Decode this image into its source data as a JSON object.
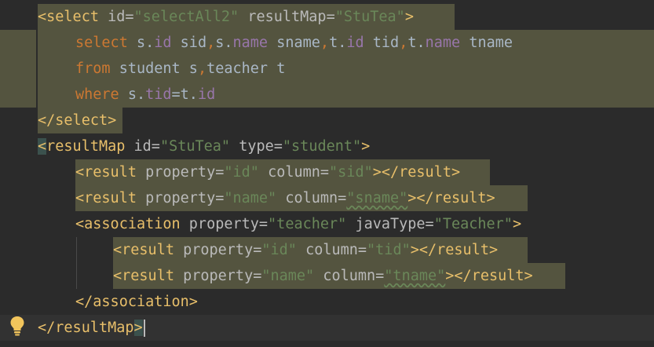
{
  "editor": {
    "lines": [
      {
        "id": "l1",
        "segments": [
          [
            "tag",
            "<select "
          ],
          [
            "attr",
            "id="
          ],
          [
            "str",
            "\"selectAll2\" "
          ],
          [
            "attr",
            "resultMap="
          ],
          [
            "str",
            "\"StuTea\""
          ],
          [
            "tag",
            ">"
          ]
        ]
      },
      {
        "id": "l2",
        "segments": [
          [
            "kw",
            "select "
          ],
          [
            "plain",
            "s."
          ],
          [
            "fld",
            "id "
          ],
          [
            "plain",
            "sid"
          ],
          [
            "kw",
            ","
          ],
          [
            "plain",
            "s."
          ],
          [
            "fld",
            "name "
          ],
          [
            "plain",
            "sname"
          ],
          [
            "kw",
            ","
          ],
          [
            "plain",
            "t."
          ],
          [
            "fld",
            "id "
          ],
          [
            "plain",
            "tid"
          ],
          [
            "kw",
            ","
          ],
          [
            "plain",
            "t."
          ],
          [
            "fld",
            "name "
          ],
          [
            "plain",
            "tname"
          ]
        ]
      },
      {
        "id": "l3",
        "segments": [
          [
            "kw",
            "from "
          ],
          [
            "plain",
            "student s"
          ],
          [
            "kw",
            ","
          ],
          [
            "plain",
            "teacher t"
          ]
        ]
      },
      {
        "id": "l4",
        "segments": [
          [
            "kw",
            "where "
          ],
          [
            "plain",
            "s."
          ],
          [
            "fld",
            "tid"
          ],
          [
            "plain",
            "=t."
          ],
          [
            "fld",
            "id"
          ]
        ]
      },
      {
        "id": "l5",
        "segments": [
          [
            "tag",
            "</select>"
          ]
        ]
      },
      {
        "id": "l6",
        "segments": [
          [
            "tag",
            "<resultMap "
          ],
          [
            "attr",
            "id="
          ],
          [
            "str",
            "\"StuTea\" "
          ],
          [
            "attr",
            "type="
          ],
          [
            "str",
            "\"student\""
          ],
          [
            "tag",
            ">"
          ]
        ]
      },
      {
        "id": "l7",
        "segments": [
          [
            "tag",
            "<result "
          ],
          [
            "attr",
            "property="
          ],
          [
            "str",
            "\"id\" "
          ],
          [
            "attr",
            "column="
          ],
          [
            "str",
            "\"sid\""
          ],
          [
            "tag",
            "></result>"
          ]
        ]
      },
      {
        "id": "l8",
        "segments": [
          [
            "tag",
            "<result "
          ],
          [
            "attr",
            "property="
          ],
          [
            "str",
            "\"name\" "
          ],
          [
            "attr",
            "column="
          ],
          [
            "str",
            "\"sname\""
          ],
          [
            "tag",
            "></result>"
          ]
        ]
      },
      {
        "id": "l9",
        "segments": [
          [
            "tag",
            "<association "
          ],
          [
            "attr",
            "property="
          ],
          [
            "str",
            "\"teacher\" "
          ],
          [
            "attr",
            "javaType="
          ],
          [
            "str",
            "\"Teacher\""
          ],
          [
            "tag",
            ">"
          ]
        ]
      },
      {
        "id": "l10",
        "segments": [
          [
            "tag",
            "<result "
          ],
          [
            "attr",
            "property="
          ],
          [
            "str",
            "\"id\" "
          ],
          [
            "attr",
            "column="
          ],
          [
            "str",
            "\"tid\""
          ],
          [
            "tag",
            "></result>"
          ]
        ]
      },
      {
        "id": "l11",
        "segments": [
          [
            "tag",
            "<result "
          ],
          [
            "attr",
            "property="
          ],
          [
            "str",
            "\"name\" "
          ],
          [
            "attr",
            "column="
          ],
          [
            "str",
            "\"tname\""
          ],
          [
            "tag",
            "></result>"
          ]
        ]
      },
      {
        "id": "l12",
        "segments": [
          [
            "tag",
            "</association>"
          ]
        ]
      },
      {
        "id": "l13",
        "segments": [
          [
            "tag",
            "</resultMap>"
          ]
        ]
      }
    ],
    "gutter_icon": "lightbulb-icon",
    "colors": {
      "background": "#2b2b2b",
      "tag": "#e8bf6a",
      "attribute": "#bababa",
      "string": "#6a8759",
      "keyword": "#cc7832",
      "field": "#9876aa",
      "text": "#a9b7c6",
      "highlight": "#54543f"
    }
  }
}
